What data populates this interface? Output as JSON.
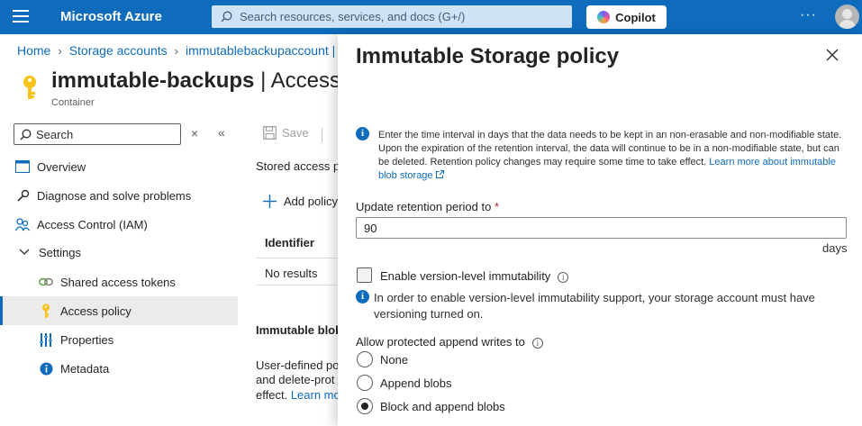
{
  "topbar": {
    "brand": "Microsoft Azure",
    "search_placeholder": "Search resources, services, and docs (G+/)",
    "copilot_label": "Copilot",
    "ellipsis": "···"
  },
  "breadcrumb": {
    "items": [
      "Home",
      "Storage accounts",
      "immutablebackupaccount |"
    ]
  },
  "resource": {
    "name": "immutable-backups",
    "section": "| Access p",
    "type": "Container"
  },
  "nav": {
    "search_placeholder": "Search",
    "clear": "×",
    "collapse": "«",
    "items": [
      {
        "label": "Overview",
        "icon": "overview-icon"
      },
      {
        "label": "Diagnose and solve problems",
        "icon": "wrench-icon"
      },
      {
        "label": "Access Control (IAM)",
        "icon": "people-icon"
      },
      {
        "label": "Settings",
        "icon": "chevron-down-icon"
      },
      {
        "label": "Shared access tokens",
        "icon": "link-icon"
      },
      {
        "label": "Access policy",
        "icon": "key-icon"
      },
      {
        "label": "Properties",
        "icon": "properties-icon"
      },
      {
        "label": "Metadata",
        "icon": "info-icon"
      }
    ],
    "active": "Access policy"
  },
  "main": {
    "save_label": "Save",
    "stored_policies": "Stored access p",
    "add_policy": "Add policy",
    "identifier_header": "Identifier",
    "no_results": "No results",
    "immutable_heading": "Immutable blob",
    "desc_line1": "User-defined po",
    "desc_line2": "and delete-prot",
    "desc_line3_text": "effect.",
    "desc_line3_link": "Learn mo"
  },
  "panel": {
    "title": "Immutable Storage policy",
    "info_text": "Enter the time interval in days that the data needs to be kept in an non-erasable and non-modifiable state. Upon the expiration of the retention interval, the data will continue to be in a non-modifiable state, but can be deleted. Retention policy changes may require some time to take effect.",
    "info_link": "Learn more about immutable blob storage",
    "retention_label": "Update retention period to",
    "required_marker": "*",
    "retention_value": "90",
    "retention_unit": "days",
    "version_checkbox_label": "Enable version-level immutability",
    "version_checked": false,
    "version_info": "In order to enable version-level immutability support, your storage account must have versioning turned on.",
    "append_label": "Allow protected append writes to",
    "append_options": [
      "None",
      "Append blobs",
      "Block and append blobs"
    ],
    "append_selected": "Block and append blobs"
  },
  "colors": {
    "topbar": "#0f6cbd",
    "accent": "#0f6cbd",
    "required": "#a4262c",
    "key": "#f8c21b"
  }
}
